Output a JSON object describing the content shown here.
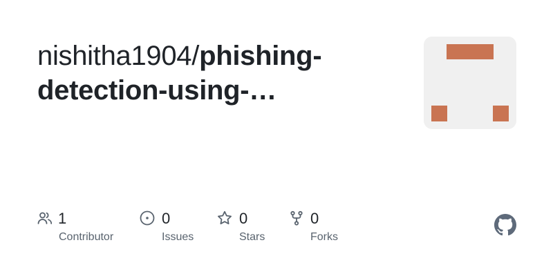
{
  "repo": {
    "owner": "nishitha1904/",
    "name_line1": "phishing-",
    "name_line2": "detection-using-…"
  },
  "avatar": {
    "background_color": "#f0f0f0",
    "block_color": "#c97452"
  },
  "stats": {
    "contributors": {
      "count": "1",
      "label": "Contributor",
      "icon": "people-icon"
    },
    "issues": {
      "count": "0",
      "label": "Issues",
      "icon": "issue-opened-icon"
    },
    "stars": {
      "count": "0",
      "label": "Stars",
      "icon": "star-icon"
    },
    "forks": {
      "count": "0",
      "label": "Forks",
      "icon": "repo-forked-icon"
    }
  },
  "brand": {
    "icon": "github-mark-icon",
    "color": "#5e6a7a"
  }
}
